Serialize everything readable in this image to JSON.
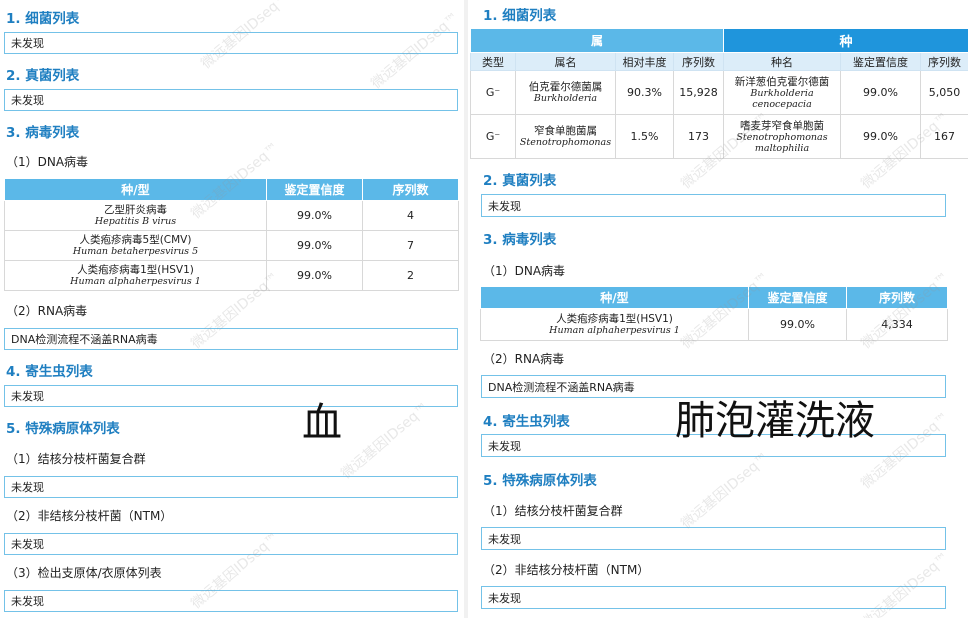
{
  "left": {
    "s1_title": "1. 细菌列表",
    "s1_value": "未发现",
    "s2_title": "2. 真菌列表",
    "s2_value": "未发现",
    "s3_title": "3. 病毒列表",
    "dna_title": "（1）DNA病毒",
    "virus_headers": [
      "种/型",
      "鉴定置信度",
      "序列数"
    ],
    "virus_rows": [
      {
        "cn": "乙型肝炎病毒",
        "latin": "Hepatitis B virus",
        "conf": "99.0%",
        "count": "4"
      },
      {
        "cn": "人类疱疹病毒5型(CMV)",
        "latin": "Human betaherpesvirus 5",
        "conf": "99.0%",
        "count": "7"
      },
      {
        "cn": "人类疱疹病毒1型(HSV1)",
        "latin": "Human alphaherpesvirus 1",
        "conf": "99.0%",
        "count": "2"
      }
    ],
    "rna_title": "（2）RNA病毒",
    "rna_value": "DNA检测流程不涵盖RNA病毒",
    "s4_title": "4. 寄生虫列表",
    "s4_value": "未发现",
    "s5_title": "5. 特殊病原体列表",
    "tb_title": "（1）结核分枝杆菌复合群",
    "tb_value": "未发现",
    "ntm_title": "（2）非结核分枝杆菌（NTM）",
    "ntm_value": "未发现",
    "myco_title": "（3）检出支原体/衣原体列表",
    "myco_value": "未发现",
    "sample_label": "血"
  },
  "right": {
    "s1_title": "1. 细菌列表",
    "genus_header": "属",
    "species_header": "种",
    "bact_subheaders": [
      "类型",
      "属名",
      "相对丰度",
      "序列数",
      "种名",
      "鉴定置信度",
      "序列数"
    ],
    "bact_rows": [
      {
        "type": "G⁻",
        "genus_cn": "伯克霍尔德菌属",
        "genus_latin": "Burkholderia",
        "abundance": "90.3%",
        "genus_count": "15,928",
        "species_cn": "新洋葱伯克霍尔德菌",
        "species_latin": "Burkholderia cenocepacia",
        "conf": "99.0%",
        "species_count": "5,050"
      },
      {
        "type": "G⁻",
        "genus_cn": "窄食单胞菌属",
        "genus_latin": "Stenotrophomonas",
        "abundance": "1.5%",
        "genus_count": "173",
        "species_cn": "嗜麦芽窄食单胞菌",
        "species_latin": "Stenotrophomonas maltophilia",
        "conf": "99.0%",
        "species_count": "167"
      }
    ],
    "s2_title": "2. 真菌列表",
    "s2_value": "未发现",
    "s3_title": "3. 病毒列表",
    "dna_title": "（1）DNA病毒",
    "virus_headers": [
      "种/型",
      "鉴定置信度",
      "序列数"
    ],
    "virus_rows": [
      {
        "cn": "人类疱疹病毒1型(HSV1)",
        "latin": "Human alphaherpesvirus 1",
        "conf": "99.0%",
        "count": "4,334"
      }
    ],
    "rna_title": "（2）RNA病毒",
    "rna_value": "DNA检测流程不涵盖RNA病毒",
    "s4_title": "4. 寄生虫列表",
    "s4_value": "未发现",
    "s5_title": "5. 特殊病原体列表",
    "tb_title": "（1）结核分枝杆菌复合群",
    "tb_value": "未发现",
    "ntm_title": "（2）非结核分枝杆菌（NTM）",
    "ntm_value": "未发现",
    "sample_label": "肺泡灌洗液"
  },
  "watermark": "微远基因IDseq™",
  "colors": {
    "heading": "#1f7fc1",
    "table_header": "#5bb8e8",
    "table_header_dark": "#1f95dc",
    "box_border": "#74c2e8"
  }
}
